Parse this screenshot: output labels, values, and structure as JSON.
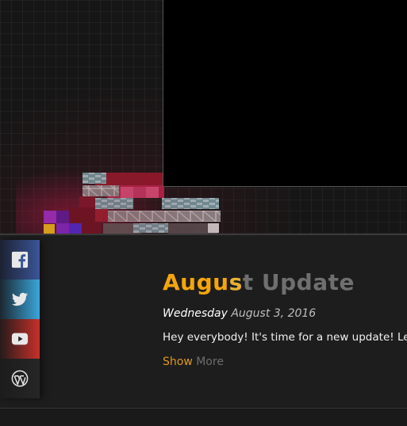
{
  "hero": {
    "video": {
      "state": "blank"
    }
  },
  "social": [
    {
      "name": "facebook",
      "icon": "facebook-icon",
      "color": "#3b5598"
    },
    {
      "name": "twitter",
      "icon": "twitter-icon",
      "color": "#3aa6dc"
    },
    {
      "name": "youtube",
      "icon": "youtube-icon",
      "color": "#c8302a"
    },
    {
      "name": "wordpress",
      "icon": "wordpress-icon",
      "color": "#262626"
    }
  ],
  "post": {
    "title_part1": "Augu",
    "title_part2": "s",
    "title_part3": "t Update",
    "date_weekday": "Wednesday",
    "date_rest": " August 3, 2016",
    "body": "Hey everybody! It's time for a new update! Let's",
    "show_more_a": "Show",
    "show_more_b": " More"
  },
  "colors": {
    "accent": "#f5a60c",
    "muted": "#6f6f6f",
    "background": "#1d1d1d"
  }
}
